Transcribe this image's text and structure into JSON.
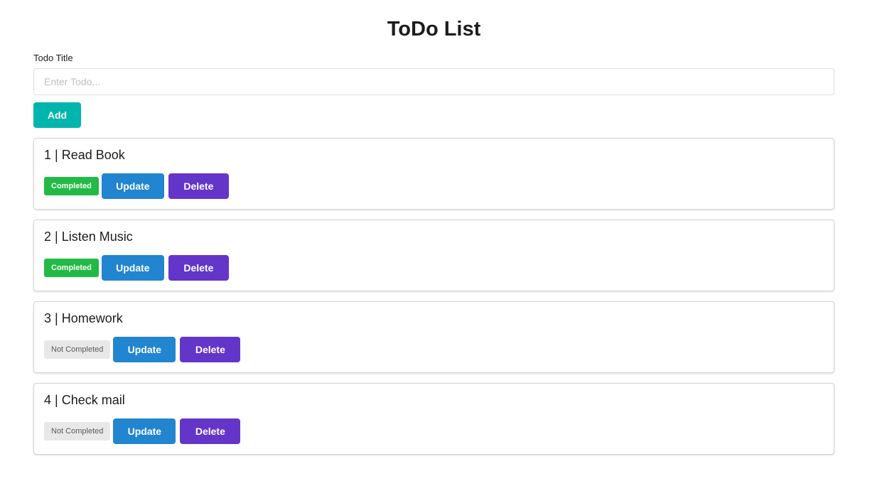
{
  "header": {
    "title": "ToDo List"
  },
  "form": {
    "label": "Todo Title",
    "placeholder": "Enter Todo...",
    "value": "",
    "add_label": "Add"
  },
  "todos": [
    {
      "title": "1 | Read Book",
      "status": "Completed",
      "update_label": "Update",
      "delete_label": "Delete"
    },
    {
      "title": "2 | Listen Music",
      "status": "Completed",
      "update_label": "Update",
      "delete_label": "Delete"
    },
    {
      "title": "3 | Homework",
      "status": "Not Completed",
      "update_label": "Update",
      "delete_label": "Delete"
    },
    {
      "title": "4 | Check mail",
      "status": "Not Completed",
      "update_label": "Update",
      "delete_label": "Delete"
    }
  ],
  "colors": {
    "add": "#00b5ad",
    "completed": "#21ba45",
    "not_completed": "#e8e8e8",
    "update": "#2185d0",
    "delete": "#6435c9"
  }
}
